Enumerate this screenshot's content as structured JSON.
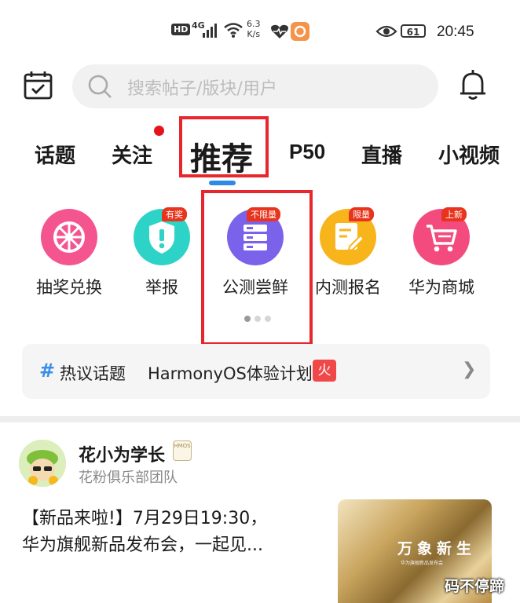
{
  "status_bar": {
    "hd": "HD",
    "network": "4G",
    "speed_value": "6.3",
    "speed_unit": "K/s",
    "battery": "61",
    "time": "20:45"
  },
  "search": {
    "placeholder": "搜索帖子/版块/用户"
  },
  "tabs": [
    {
      "label": "话题"
    },
    {
      "label": "关注"
    },
    {
      "label": "推荐"
    },
    {
      "label": "P50"
    },
    {
      "label": "直播"
    },
    {
      "label": "小视频"
    }
  ],
  "quick_actions": [
    {
      "label": "抽奖兑换",
      "badge": "",
      "color": "#f5558f",
      "icon": "wheel-icon"
    },
    {
      "label": "举报",
      "badge": "有奖",
      "color": "#2ed3c7",
      "icon": "shield-alert-icon"
    },
    {
      "label": "公测尝鲜",
      "badge": "不限量",
      "color": "#7b62ea",
      "icon": "server-icon"
    },
    {
      "label": "内测报名",
      "badge": "限量",
      "color": "#f8b41b",
      "icon": "form-edit-icon"
    },
    {
      "label": "华为商城",
      "badge": "上新",
      "color": "#f44b7f",
      "icon": "cart-icon"
    }
  ],
  "hot_topic": {
    "hash": "#",
    "label": "热议话题",
    "topic": "HarmonyOS体验计划",
    "fire": "火"
  },
  "post": {
    "author": "花小为学长",
    "badge_text": "HMOS",
    "team": "花粉俱乐部团队",
    "text_line1": "【新品来啦!】7月29日19:30，",
    "text_line2": "华为旗舰新品发布会，一起见...",
    "thumb_title": "万象新生",
    "thumb_sub": "华为旗舰新品发布会"
  },
  "watermark": "码不停蹄",
  "colors": {
    "accent_blue": "#2f8ae6",
    "highlight_red": "#e8262d",
    "notification_red": "#e5131c"
  }
}
